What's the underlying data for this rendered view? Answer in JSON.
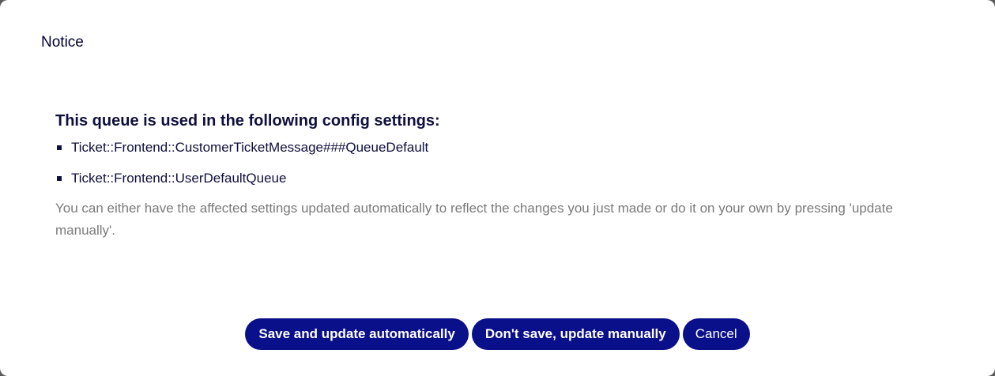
{
  "dialog": {
    "title": "Notice",
    "heading": "This queue is used in the following config settings:",
    "settings": [
      "Ticket::Frontend::CustomerTicketMessage###QueueDefault",
      "Ticket::Frontend::UserDefaultQueue"
    ],
    "description": "You can either have the affected settings updated automatically to reflect the changes you just made or do it on your own by pressing 'update manually'."
  },
  "buttons": {
    "save_auto": "Save and update automatically",
    "save_manual": "Don't save, update manually",
    "cancel": "Cancel"
  },
  "colors": {
    "button_bg": "#0a0f8a",
    "heading_text": "#0e0f3d",
    "description_text": "#7a7a7a"
  }
}
